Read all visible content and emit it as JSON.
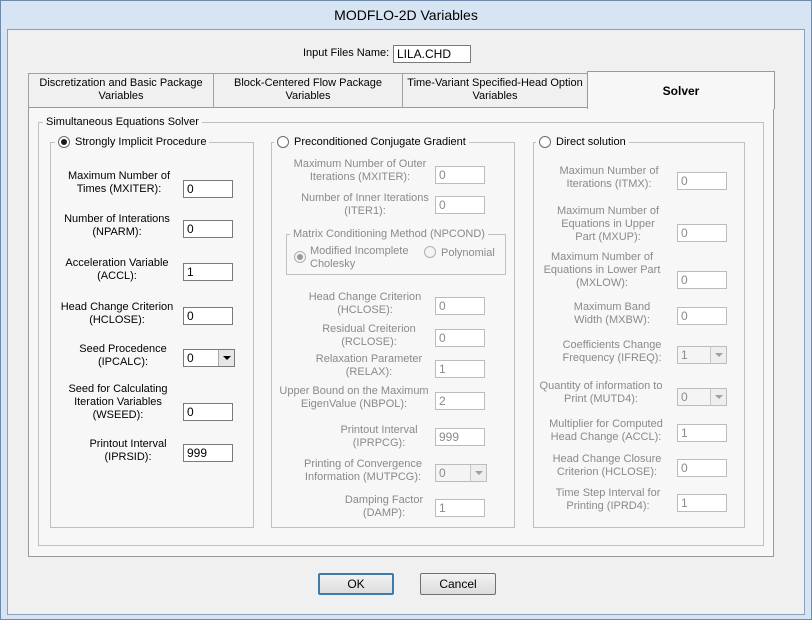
{
  "window": {
    "title": "MODFLO-2D Variables"
  },
  "input_files": {
    "label": "Input Files Name:",
    "value": "LILA.CHD"
  },
  "tabs": [
    {
      "label": "Discretization and Basic Package Variables"
    },
    {
      "label": "Block-Centered Flow Package Variables"
    },
    {
      "label": "Time-Variant Specified-Head Option Variables"
    },
    {
      "label": "Solver"
    }
  ],
  "solver_group": {
    "title": "Simultaneous Equations Solver"
  },
  "sip": {
    "title": "Strongly Implicit Procedure",
    "fields": [
      {
        "label": "Maximum Number of Times (MXITER):",
        "value": "0"
      },
      {
        "label": "Number of Interations (NPARM):",
        "value": "0"
      },
      {
        "label": "Acceleration Variable (ACCL):",
        "value": "1"
      },
      {
        "label": "Head Change Criterion (HCLOSE):",
        "value": "0"
      },
      {
        "label": "Seed Procedence (IPCALC):",
        "value": "0"
      },
      {
        "label": "Seed for Calculating Iteration Variables (WSEED):",
        "value": "0"
      },
      {
        "label": "Printout Interval (IPRSID):",
        "value": "999"
      }
    ]
  },
  "pcg": {
    "title": "Preconditioned Conjugate Gradient",
    "fields_top": [
      {
        "label": "Maximum Number of Outer Iterations (MXITER):",
        "value": "0"
      },
      {
        "label": "Number of Inner Iterations (ITER1):",
        "value": "0"
      }
    ],
    "npcond": {
      "title": "Matrix Conditioning Method (NPCOND)",
      "option1": "Modified Incomplete Cholesky",
      "option2": "Polynomial"
    },
    "fields_bottom": [
      {
        "label": "Head Change Criterion (HCLOSE):",
        "value": "0"
      },
      {
        "label": "Residual Creiterion (RCLOSE):",
        "value": "0"
      },
      {
        "label": "Relaxation Parameter (RELAX):",
        "value": "1"
      },
      {
        "label": "Upper Bound on the Maximum EigenValue (NBPOL):",
        "value": "2"
      },
      {
        "label": "Printout Interval (IPRPCG):",
        "value": "999"
      },
      {
        "label": "Printing of Convergence Information (MUTPCG):",
        "value": "0"
      },
      {
        "label": "Damping Factor (DAMP):",
        "value": "1"
      }
    ]
  },
  "direct": {
    "title": "Direct solution",
    "fields": [
      {
        "label": "Maximun Number of Iterations (ITMX):",
        "value": "0"
      },
      {
        "label": "Maximum Number of Equations in Upper Part (MXUP):",
        "value": "0"
      },
      {
        "label": "Maximum Number of Equations in Lower Part (MXLOW):",
        "value": "0"
      },
      {
        "label": "Maximum Band Width (MXBW):",
        "value": "0"
      },
      {
        "label": "Coefficients Change Frequency (IFREQ):",
        "value": "1"
      },
      {
        "label": "Quantity of information to Print (MUTD4):",
        "value": "0"
      },
      {
        "label": "Multiplier for Computed Head Change (ACCL):",
        "value": "1"
      },
      {
        "label": "Head Change Closure Criterion (HCLOSE):",
        "value": "0"
      },
      {
        "label": "Time Step Interval for Printing (IPRD4):",
        "value": "1"
      }
    ]
  },
  "buttons": {
    "ok": "OK",
    "cancel": "Cancel"
  }
}
